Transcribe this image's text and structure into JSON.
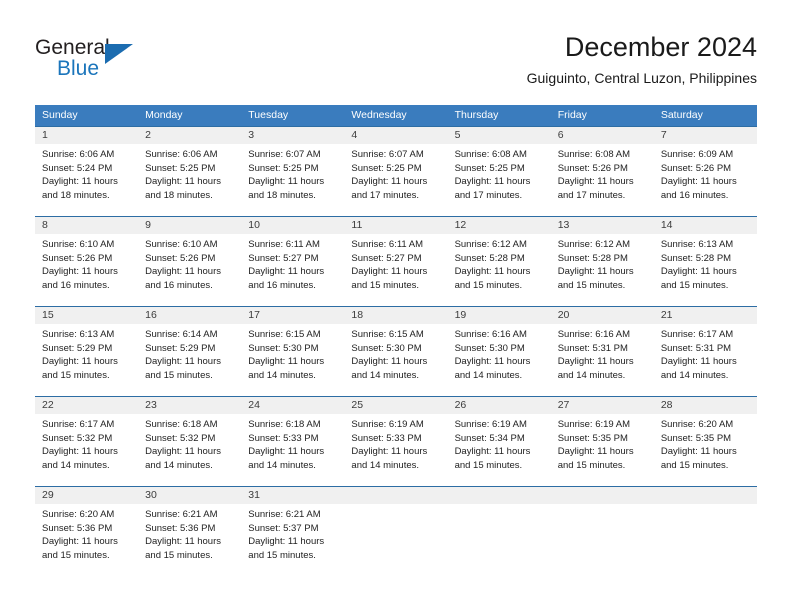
{
  "logo": {
    "primary_text": "General",
    "secondary_text": "Blue",
    "primary_color": "#231f20",
    "secondary_color": "#1b75bb",
    "triangle_color": "#1b6cb0",
    "icon": "triangle-flag-icon"
  },
  "header": {
    "title": "December 2024",
    "subtitle": "Guiguinto, Central Luzon, Philippines"
  },
  "colors": {
    "header_row_bg": "#3a7cbe",
    "header_row_text": "#ffffff",
    "week_divider": "#2d6da4",
    "daynum_band_bg": "#f0f0f0",
    "body_text": "#222222"
  },
  "calendar": {
    "weekday_headers": [
      "Sunday",
      "Monday",
      "Tuesday",
      "Wednesday",
      "Thursday",
      "Friday",
      "Saturday"
    ],
    "weeks": [
      [
        {
          "day": "1",
          "lines": [
            "Sunrise: 6:06 AM",
            "Sunset: 5:24 PM",
            "Daylight: 11 hours",
            "and 18 minutes."
          ]
        },
        {
          "day": "2",
          "lines": [
            "Sunrise: 6:06 AM",
            "Sunset: 5:25 PM",
            "Daylight: 11 hours",
            "and 18 minutes."
          ]
        },
        {
          "day": "3",
          "lines": [
            "Sunrise: 6:07 AM",
            "Sunset: 5:25 PM",
            "Daylight: 11 hours",
            "and 18 minutes."
          ]
        },
        {
          "day": "4",
          "lines": [
            "Sunrise: 6:07 AM",
            "Sunset: 5:25 PM",
            "Daylight: 11 hours",
            "and 17 minutes."
          ]
        },
        {
          "day": "5",
          "lines": [
            "Sunrise: 6:08 AM",
            "Sunset: 5:25 PM",
            "Daylight: 11 hours",
            "and 17 minutes."
          ]
        },
        {
          "day": "6",
          "lines": [
            "Sunrise: 6:08 AM",
            "Sunset: 5:26 PM",
            "Daylight: 11 hours",
            "and 17 minutes."
          ]
        },
        {
          "day": "7",
          "lines": [
            "Sunrise: 6:09 AM",
            "Sunset: 5:26 PM",
            "Daylight: 11 hours",
            "and 16 minutes."
          ]
        }
      ],
      [
        {
          "day": "8",
          "lines": [
            "Sunrise: 6:10 AM",
            "Sunset: 5:26 PM",
            "Daylight: 11 hours",
            "and 16 minutes."
          ]
        },
        {
          "day": "9",
          "lines": [
            "Sunrise: 6:10 AM",
            "Sunset: 5:26 PM",
            "Daylight: 11 hours",
            "and 16 minutes."
          ]
        },
        {
          "day": "10",
          "lines": [
            "Sunrise: 6:11 AM",
            "Sunset: 5:27 PM",
            "Daylight: 11 hours",
            "and 16 minutes."
          ]
        },
        {
          "day": "11",
          "lines": [
            "Sunrise: 6:11 AM",
            "Sunset: 5:27 PM",
            "Daylight: 11 hours",
            "and 15 minutes."
          ]
        },
        {
          "day": "12",
          "lines": [
            "Sunrise: 6:12 AM",
            "Sunset: 5:28 PM",
            "Daylight: 11 hours",
            "and 15 minutes."
          ]
        },
        {
          "day": "13",
          "lines": [
            "Sunrise: 6:12 AM",
            "Sunset: 5:28 PM",
            "Daylight: 11 hours",
            "and 15 minutes."
          ]
        },
        {
          "day": "14",
          "lines": [
            "Sunrise: 6:13 AM",
            "Sunset: 5:28 PM",
            "Daylight: 11 hours",
            "and 15 minutes."
          ]
        }
      ],
      [
        {
          "day": "15",
          "lines": [
            "Sunrise: 6:13 AM",
            "Sunset: 5:29 PM",
            "Daylight: 11 hours",
            "and 15 minutes."
          ]
        },
        {
          "day": "16",
          "lines": [
            "Sunrise: 6:14 AM",
            "Sunset: 5:29 PM",
            "Daylight: 11 hours",
            "and 15 minutes."
          ]
        },
        {
          "day": "17",
          "lines": [
            "Sunrise: 6:15 AM",
            "Sunset: 5:30 PM",
            "Daylight: 11 hours",
            "and 14 minutes."
          ]
        },
        {
          "day": "18",
          "lines": [
            "Sunrise: 6:15 AM",
            "Sunset: 5:30 PM",
            "Daylight: 11 hours",
            "and 14 minutes."
          ]
        },
        {
          "day": "19",
          "lines": [
            "Sunrise: 6:16 AM",
            "Sunset: 5:30 PM",
            "Daylight: 11 hours",
            "and 14 minutes."
          ]
        },
        {
          "day": "20",
          "lines": [
            "Sunrise: 6:16 AM",
            "Sunset: 5:31 PM",
            "Daylight: 11 hours",
            "and 14 minutes."
          ]
        },
        {
          "day": "21",
          "lines": [
            "Sunrise: 6:17 AM",
            "Sunset: 5:31 PM",
            "Daylight: 11 hours",
            "and 14 minutes."
          ]
        }
      ],
      [
        {
          "day": "22",
          "lines": [
            "Sunrise: 6:17 AM",
            "Sunset: 5:32 PM",
            "Daylight: 11 hours",
            "and 14 minutes."
          ]
        },
        {
          "day": "23",
          "lines": [
            "Sunrise: 6:18 AM",
            "Sunset: 5:32 PM",
            "Daylight: 11 hours",
            "and 14 minutes."
          ]
        },
        {
          "day": "24",
          "lines": [
            "Sunrise: 6:18 AM",
            "Sunset: 5:33 PM",
            "Daylight: 11 hours",
            "and 14 minutes."
          ]
        },
        {
          "day": "25",
          "lines": [
            "Sunrise: 6:19 AM",
            "Sunset: 5:33 PM",
            "Daylight: 11 hours",
            "and 14 minutes."
          ]
        },
        {
          "day": "26",
          "lines": [
            "Sunrise: 6:19 AM",
            "Sunset: 5:34 PM",
            "Daylight: 11 hours",
            "and 15 minutes."
          ]
        },
        {
          "day": "27",
          "lines": [
            "Sunrise: 6:19 AM",
            "Sunset: 5:35 PM",
            "Daylight: 11 hours",
            "and 15 minutes."
          ]
        },
        {
          "day": "28",
          "lines": [
            "Sunrise: 6:20 AM",
            "Sunset: 5:35 PM",
            "Daylight: 11 hours",
            "and 15 minutes."
          ]
        }
      ],
      [
        {
          "day": "29",
          "lines": [
            "Sunrise: 6:20 AM",
            "Sunset: 5:36 PM",
            "Daylight: 11 hours",
            "and 15 minutes."
          ]
        },
        {
          "day": "30",
          "lines": [
            "Sunrise: 6:21 AM",
            "Sunset: 5:36 PM",
            "Daylight: 11 hours",
            "and 15 minutes."
          ]
        },
        {
          "day": "31",
          "lines": [
            "Sunrise: 6:21 AM",
            "Sunset: 5:37 PM",
            "Daylight: 11 hours",
            "and 15 minutes."
          ]
        },
        {
          "day": "",
          "lines": []
        },
        {
          "day": "",
          "lines": []
        },
        {
          "day": "",
          "lines": []
        },
        {
          "day": "",
          "lines": []
        }
      ]
    ]
  }
}
